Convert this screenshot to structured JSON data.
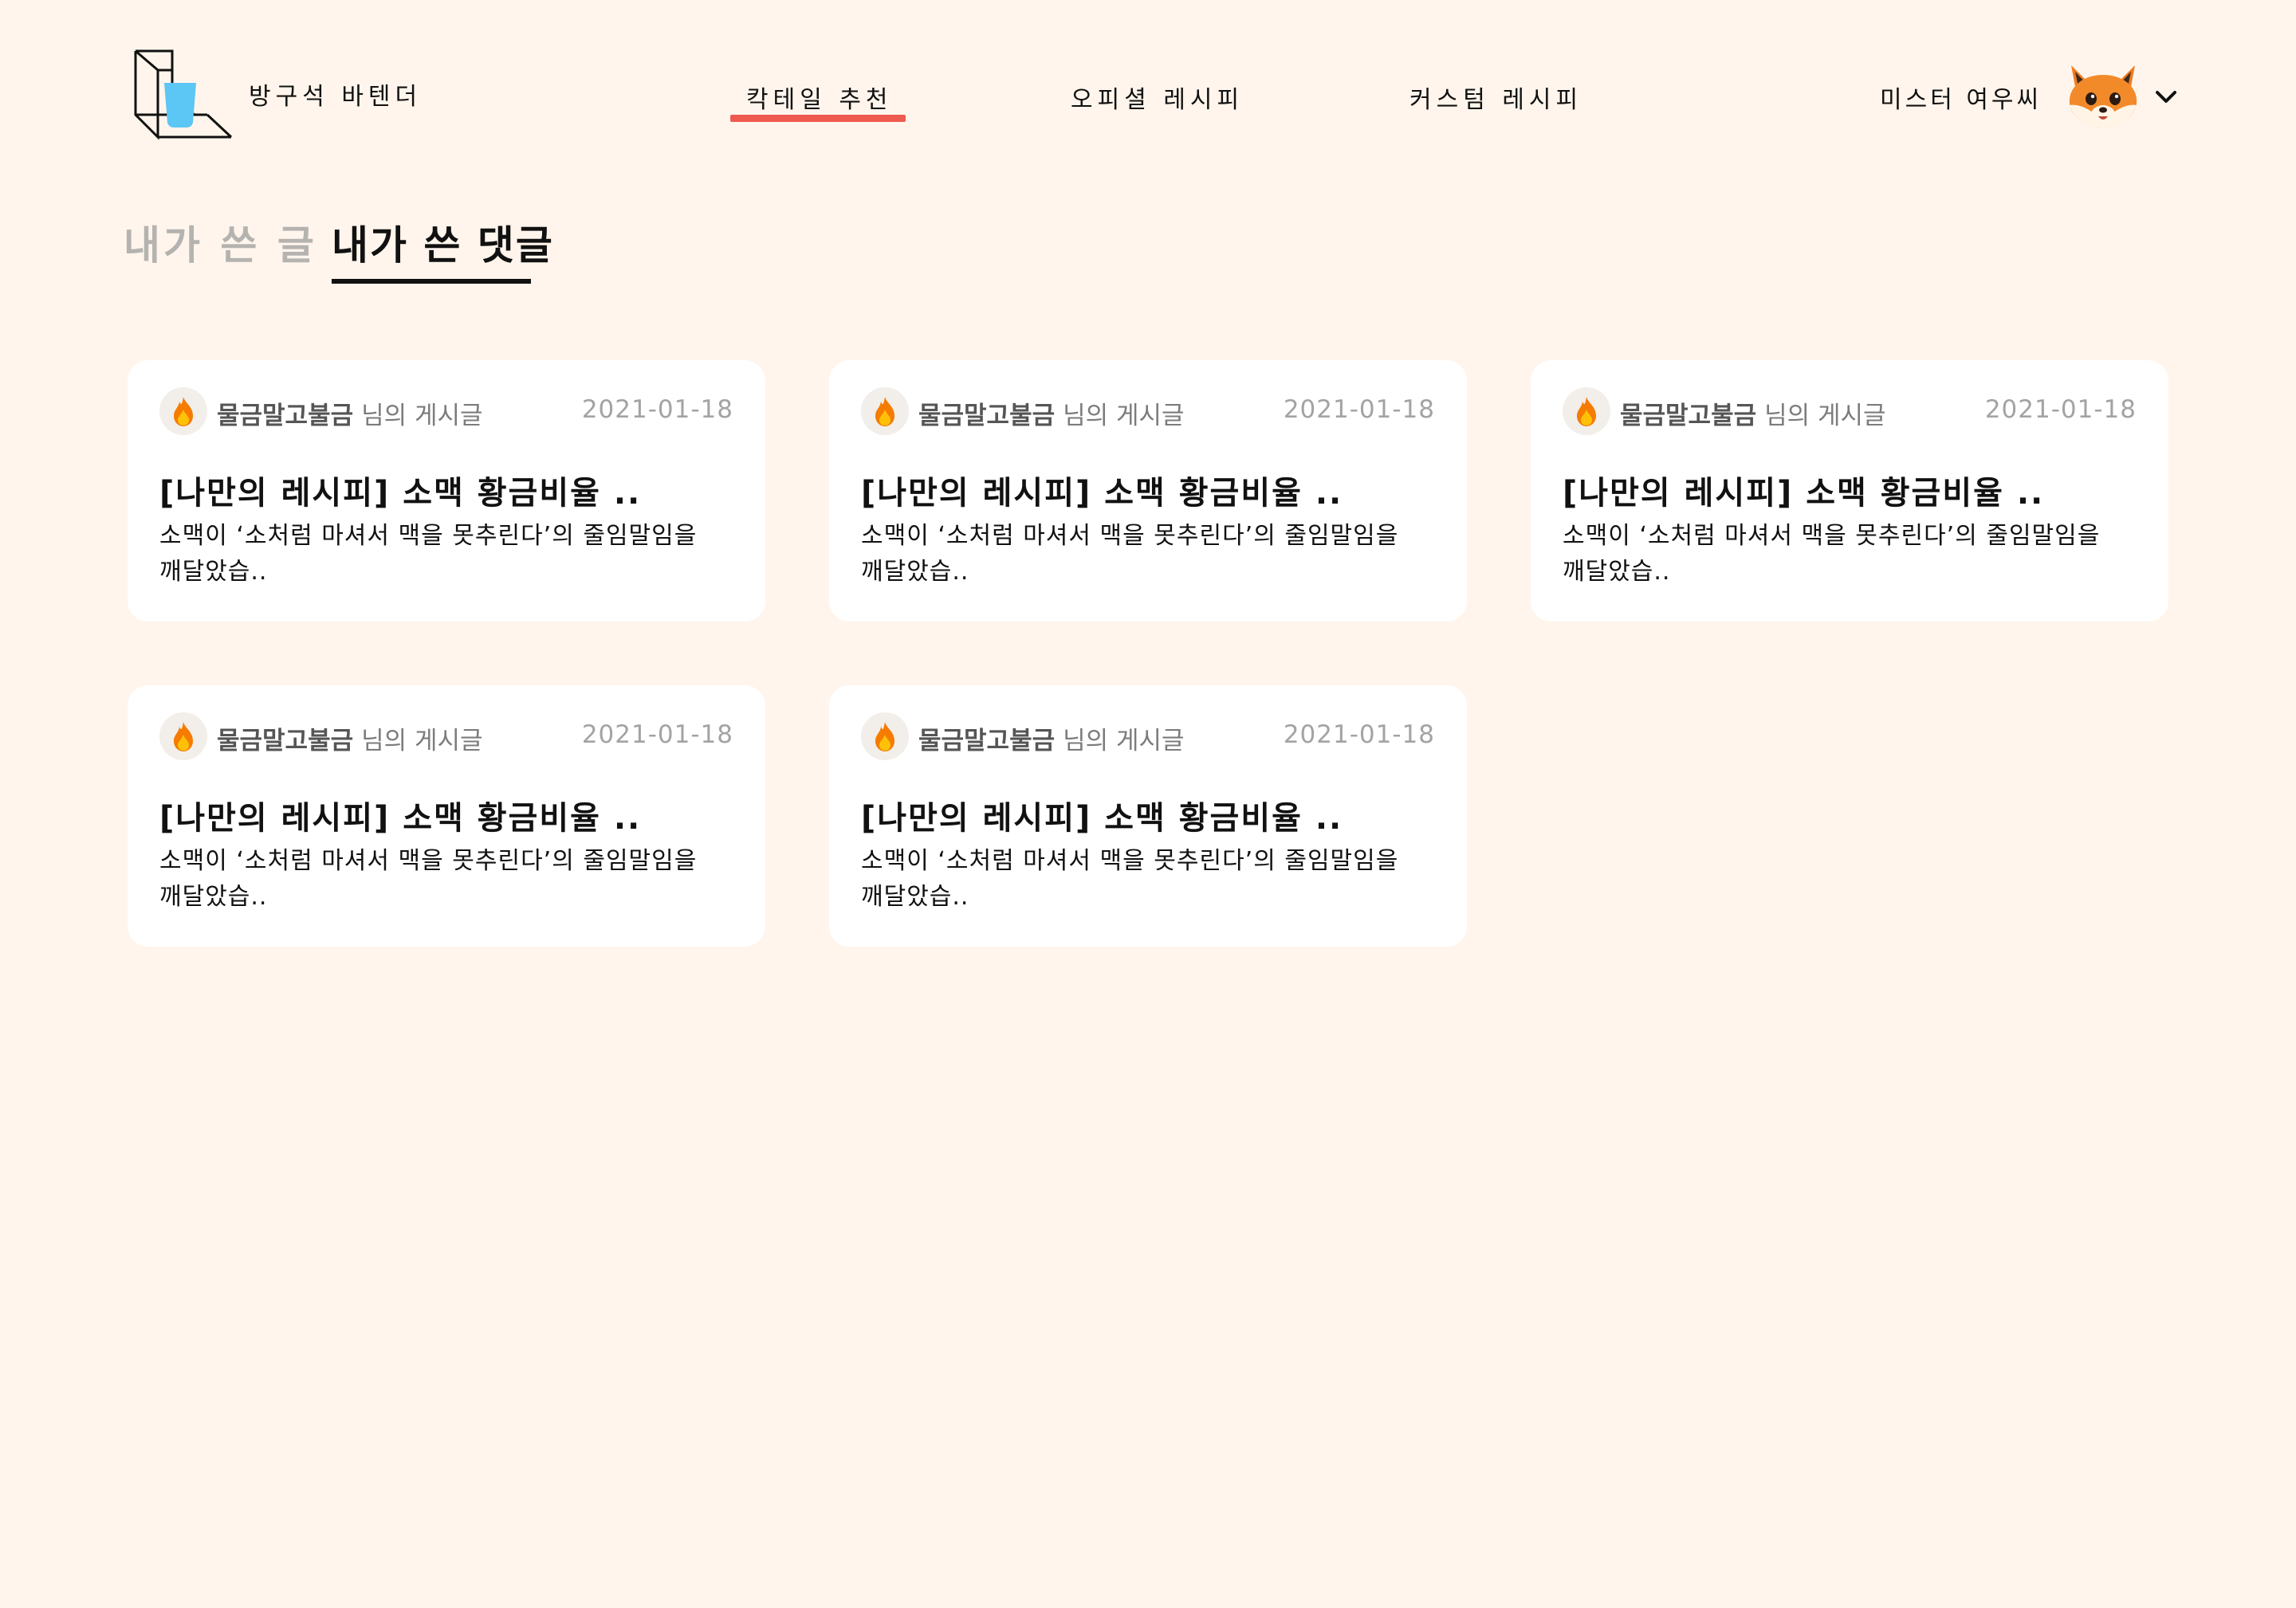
{
  "header": {
    "brand": "방구석 바텐더",
    "nav": [
      {
        "label": "칵테일 추천",
        "active": true
      },
      {
        "label": "오피셜 레시피",
        "active": false
      },
      {
        "label": "커스텀 레시피",
        "active": false
      }
    ],
    "user_name": "미스터 여우씨",
    "avatar_icon": "fox-avatar-icon",
    "accent_color": "#EE5A4F"
  },
  "tabs": [
    {
      "label": "내가 쓴 글",
      "active": false
    },
    {
      "label": "내가 쓴 댓글",
      "active": true
    }
  ],
  "cards": [
    {
      "author": "물금말고불금",
      "author_suffix": "님의 게시글",
      "date": "2021-01-18",
      "title": "[나만의 레시피] 소맥 황금비율 ..",
      "body_line1": "소맥이 ‘소처럼 마셔서 맥을 못추린다’의 줄임말임을",
      "body_line2": "깨달았습..",
      "icon": "fire-icon"
    },
    {
      "author": "물금말고불금",
      "author_suffix": "님의 게시글",
      "date": "2021-01-18",
      "title": "[나만의 레시피] 소맥 황금비율 ..",
      "body_line1": "소맥이 ‘소처럼 마셔서 맥을 못추린다’의 줄임말임을",
      "body_line2": "깨달았습..",
      "icon": "fire-icon"
    },
    {
      "author": "물금말고불금",
      "author_suffix": "님의 게시글",
      "date": "2021-01-18",
      "title": "[나만의 레시피] 소맥 황금비율 ..",
      "body_line1": "소맥이 ‘소처럼 마셔서 맥을 못추린다’의 줄임말임을",
      "body_line2": "깨달았습..",
      "icon": "fire-icon"
    },
    {
      "author": "물금말고불금",
      "author_suffix": "님의 게시글",
      "date": "2021-01-18",
      "title": "[나만의 레시피] 소맥 황금비율 ..",
      "body_line1": "소맥이 ‘소처럼 마셔서 맥을 못추린다’의 줄임말임을",
      "body_line2": "깨달았습..",
      "icon": "fire-icon"
    },
    {
      "author": "물금말고불금",
      "author_suffix": "님의 게시글",
      "date": "2021-01-18",
      "title": "[나만의 레시피] 소맥 황금비율 ..",
      "body_line1": "소맥이 ‘소처럼 마셔서 맥을 못추린다’의 줄임말임을",
      "body_line2": "깨달았습..",
      "icon": "fire-icon"
    }
  ]
}
